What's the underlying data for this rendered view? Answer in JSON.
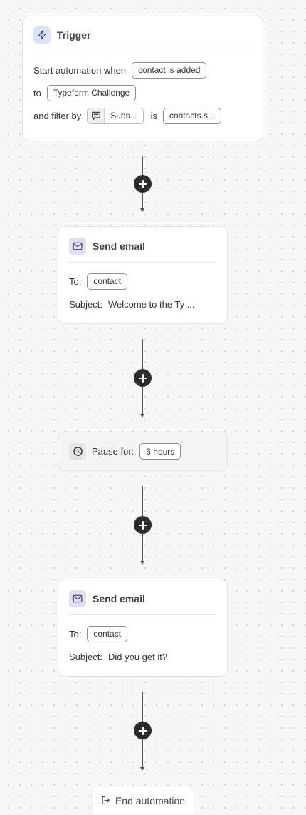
{
  "trigger": {
    "title": "Trigger",
    "icon": "lightning-icon",
    "line1_label": "Start automation when",
    "event_chip": "contact is added",
    "line2_label": "to",
    "list_chip": "Typeform Challenge",
    "line3_label": "and filter by",
    "filter_field_chip": "Subs...",
    "filter_op": "is",
    "filter_value_chip": "contacts.s..."
  },
  "email1": {
    "title": "Send email",
    "icon": "envelope-icon",
    "to_label": "To:",
    "to_chip": "contact",
    "subject_label": "Subject:",
    "subject_value": "Welcome to the Ty ..."
  },
  "pause": {
    "icon": "clock-icon",
    "label": "Pause for:",
    "duration_chip": "6 hours"
  },
  "email2": {
    "title": "Send email",
    "icon": "envelope-icon",
    "to_label": "To:",
    "to_chip": "contact",
    "subject_label": "Subject:",
    "subject_value": "Did you get it?"
  },
  "end": {
    "label": "End automation",
    "icon": "exit-icon"
  },
  "colors": {
    "canvas": "#f7f7f7",
    "trigger_icon_bg": "#d7e4fb",
    "email_icon_bg": "#e4ddf6",
    "plus_button": "#2b2b2e"
  }
}
